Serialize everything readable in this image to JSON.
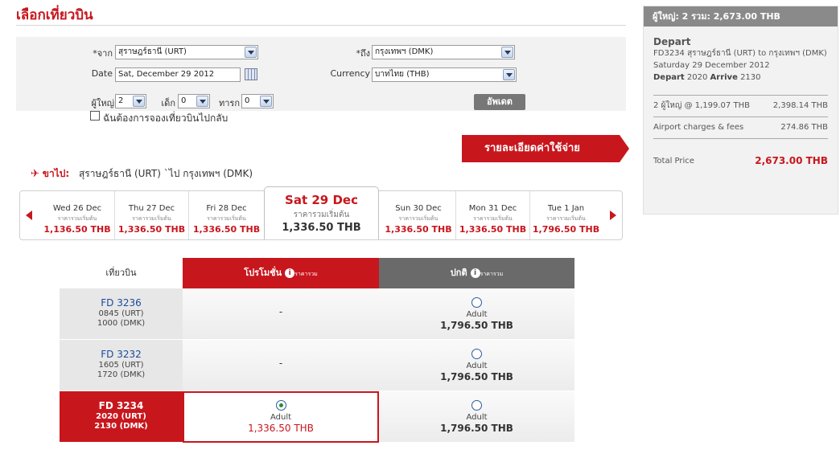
{
  "page_title": "เลือกเที่ยวบิน",
  "search": {
    "from_label": "*จาก",
    "from_value": "สุราษฎร์ธานี (URT)",
    "to_label": "*ถึง",
    "to_value": "กรุงเทพฯ (DMK)",
    "date_label": "Date",
    "date_value": "Sat, December 29 2012",
    "currency_label": "Currency",
    "currency_value": "บาทไทย (THB)",
    "adult_label": "ผู้ใหญ่",
    "adult_value": "2",
    "child_label": "เด็ก",
    "child_value": "0",
    "infant_label": "ทารก",
    "infant_value": "0",
    "return_label": "ฉันต้องการจองเที่ยวบินไปกลับ",
    "update_label": "อัพเดต"
  },
  "fare_detail_label": "รายละเอียดค่าใช้จ่าย",
  "leg": {
    "direction": "ขาไป:",
    "route": "สุราษฎร์ธานี (URT) `ไป  กรุงเทพฯ (DMK)"
  },
  "dates": [
    {
      "day": "Wed 26 Dec",
      "sub": "ราคารวมเริ่มต้น",
      "price": "1,136.50 THB"
    },
    {
      "day": "Thu 27 Dec",
      "sub": "ราคารวมเริ่มต้น",
      "price": "1,336.50 THB"
    },
    {
      "day": "Fri 28 Dec",
      "sub": "ราคารวมเริ่มต้น",
      "price": "1,336.50 THB"
    },
    {
      "day": "Sat 29 Dec",
      "sub": "ราคารวมเริ่มต้น",
      "price": "1,336.50 THB"
    },
    {
      "day": "Sun 30 Dec",
      "sub": "ราคารวมเริ่มต้น",
      "price": "1,336.50 THB"
    },
    {
      "day": "Mon 31 Dec",
      "sub": "ราคารวมเริ่มต้น",
      "price": "1,336.50 THB"
    },
    {
      "day": "Tue 1 Jan",
      "sub": "ราคารวมเริ่มต้น",
      "price": "1,796.50 THB"
    }
  ],
  "table": {
    "col_flight": "เที่ยวบิน",
    "col_promo": "โปรโมชั่น",
    "col_normal": "ปกติ",
    "col_note": "ราคารวม",
    "rows": [
      {
        "flight": "FD  3236",
        "dep": "0845  (URT)",
        "arr": "1000  (DMK)",
        "promo": "-",
        "normal_pax": "Adult",
        "normal_price": "1,796.50 THB"
      },
      {
        "flight": "FD  3232",
        "dep": "1605  (URT)",
        "arr": "1720  (DMK)",
        "promo": "-",
        "normal_pax": "Adult",
        "normal_price": "1,796.50 THB"
      },
      {
        "flight": "FD  3234",
        "dep": "2020  (URT)",
        "arr": "2130  (DMK)",
        "promo_pax": "Adult",
        "promo_price": "1,336.50 THB",
        "normal_pax": "Adult",
        "normal_price": "1,796.50 THB"
      }
    ]
  },
  "summary": {
    "header": "ผู้ใหญ่: 2  รวม: 2,673.00 THB",
    "depart_title": "Depart",
    "flight_line": "FD3234 สุราษฎร์ธานี (URT) to กรุงเทพฯ (DMK)",
    "date_line": "Saturday 29 December 2012",
    "depart_word": "Depart",
    "depart_time": "2020",
    "arrive_word": "Arrive",
    "arrive_time": "2130",
    "pax_label": "2 ผู้ใหญ่ @ 1,199.07 THB",
    "pax_value": "2,398.14 THB",
    "fees_label": "Airport charges & fees",
    "fees_value": "274.86 THB",
    "total_label": "Total Price",
    "total_value": "2,673.00 THB"
  },
  "colors": {
    "brand_red": "#c8161d",
    "header_gray": "#6a6a6a",
    "link_blue": "#1a4a9c"
  }
}
